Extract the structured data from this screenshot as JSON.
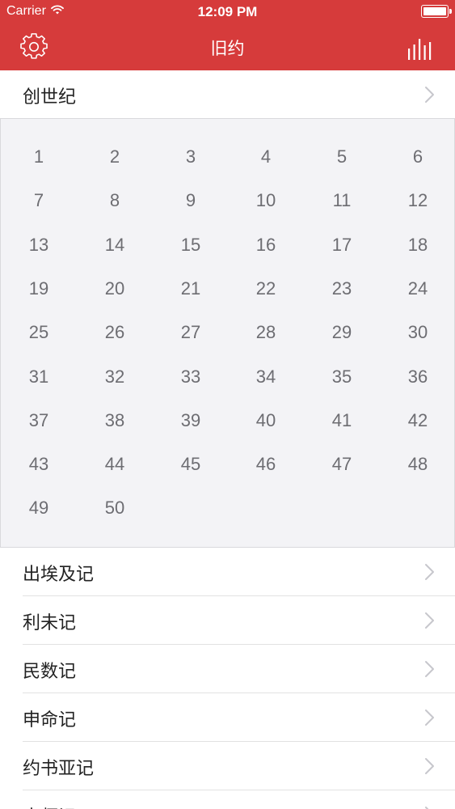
{
  "status_bar": {
    "carrier": "Carrier",
    "time": "12:09 PM"
  },
  "nav": {
    "title": "旧约"
  },
  "colors": {
    "accent": "#d63b3b",
    "panel": "#f3f3f6",
    "chapter_text": "#6d6d72"
  },
  "icons": {
    "left": "gear-icon",
    "right": "bar-chart-icon",
    "row": "chevron-right-icon"
  },
  "expanded_book": {
    "name": "创世纪",
    "chapters": [
      "1",
      "2",
      "3",
      "4",
      "5",
      "6",
      "7",
      "8",
      "9",
      "10",
      "11",
      "12",
      "13",
      "14",
      "15",
      "16",
      "17",
      "18",
      "19",
      "20",
      "21",
      "22",
      "23",
      "24",
      "25",
      "26",
      "27",
      "28",
      "29",
      "30",
      "31",
      "32",
      "33",
      "34",
      "35",
      "36",
      "37",
      "38",
      "39",
      "40",
      "41",
      "42",
      "43",
      "44",
      "45",
      "46",
      "47",
      "48",
      "49",
      "50"
    ]
  },
  "books": [
    {
      "name": "出埃及记"
    },
    {
      "name": "利未记"
    },
    {
      "name": "民数记"
    },
    {
      "name": "申命记"
    },
    {
      "name": "约书亚记"
    },
    {
      "name": "士师记"
    }
  ]
}
